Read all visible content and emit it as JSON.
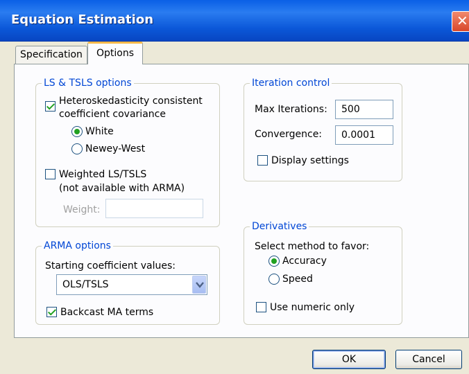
{
  "window": {
    "title": "Equation Estimation",
    "close_glyph": "✕"
  },
  "tabs": [
    {
      "label": "Specification"
    },
    {
      "label": "Options"
    }
  ],
  "ls_tsls": {
    "legend": "LS & TSLS options",
    "hetero_label_line1": "Heteroskedasticity consistent",
    "hetero_label_line2": "coefficient covariance",
    "hetero_checked": true,
    "white_label": "White",
    "newey_label": "Newey-West",
    "selected_method": "White",
    "weighted_label_line1": "Weighted LS/TSLS",
    "weighted_label_line2": "(not available with ARMA)",
    "weighted_checked": false,
    "weight_label": "Weight:",
    "weight_value": ""
  },
  "iteration": {
    "legend": "Iteration control",
    "max_iter_label": "Max Iterations:",
    "max_iter_value": "500",
    "convergence_label": "Convergence:",
    "convergence_value": "0.0001",
    "display_label": "Display settings",
    "display_checked": false
  },
  "derivatives": {
    "legend": "Derivatives",
    "select_label": "Select method to favor:",
    "accuracy_label": "Accuracy",
    "speed_label": "Speed",
    "selected_method": "Accuracy",
    "numeric_label": "Use numeric only",
    "numeric_checked": false
  },
  "arma": {
    "legend": "ARMA options",
    "starting_label": "Starting coefficient values:",
    "starting_value": "OLS/TSLS",
    "backcast_label": "Backcast MA terms",
    "backcast_checked": true
  },
  "buttons": {
    "ok": "OK",
    "cancel": "Cancel"
  },
  "colors": {
    "legend_blue": "#0046d5",
    "check_green": "#21a121",
    "title_blue": "#0a5fe6"
  }
}
